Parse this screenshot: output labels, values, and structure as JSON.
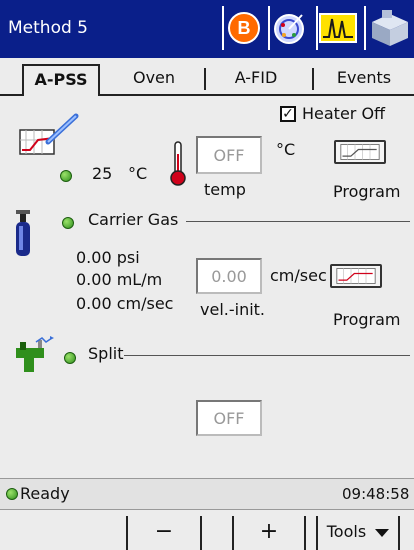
{
  "titlebar": {
    "title": "Method 5",
    "buttons": [
      {
        "icon": "circle-b-icon",
        "label": "B"
      },
      {
        "icon": "dial-icon"
      },
      {
        "icon": "signal-wave-icon"
      },
      {
        "icon": "instrument-icon"
      }
    ]
  },
  "tabs": [
    {
      "label": "A-PSS",
      "selected": true
    },
    {
      "label": "Oven"
    },
    {
      "label": "A-FID"
    },
    {
      "label": "Events"
    }
  ],
  "pss": {
    "heater_off_label": "Heater Off",
    "heater_off_checked": true,
    "temp_value": "25",
    "temp_unit": "°C",
    "temp_field": "OFF",
    "temp_field_unit": "°C",
    "temp_caption": "temp",
    "program_label": "Program"
  },
  "carrier": {
    "label": "Carrier Gas",
    "psi": "0.00 psi",
    "flow": "0.00 mL/m",
    "velocity": "0.00 cm/sec",
    "vel_field": "0.00",
    "vel_unit": "cm/sec",
    "vel_caption": "vel.-init.",
    "program_label": "Program"
  },
  "split": {
    "label": "Split",
    "field": "OFF"
  },
  "status": {
    "text": "Ready",
    "time": "09:48:58"
  },
  "bottom": {
    "minus": "−",
    "plus": "+",
    "tools": "Tools"
  },
  "colors": {
    "titlebar": "#0a1f8a",
    "led": "#3fa82a"
  }
}
